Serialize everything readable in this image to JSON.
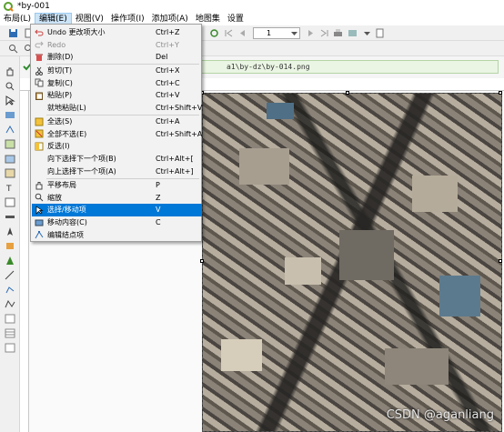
{
  "window": {
    "title": "*by-001"
  },
  "menubar": [
    {
      "label": "布局(L)"
    },
    {
      "label": "编辑(E)"
    },
    {
      "label": "视图(V)"
    },
    {
      "label": "操作项(I)"
    },
    {
      "label": "添加项(A)"
    },
    {
      "label": "地图集"
    },
    {
      "label": "设置"
    }
  ],
  "toolbar": {
    "page_selector_value": "1"
  },
  "pathbar": {
    "path_text": "a1\\by-dz\\by-014.png"
  },
  "edit_menu": {
    "items": [
      {
        "label": "Undo 更改项大小",
        "shortcut": "Ctrl+Z",
        "icon": "undo-icon",
        "enabled": true
      },
      {
        "label": "Redo",
        "shortcut": "Ctrl+Y",
        "icon": "redo-icon",
        "enabled": false
      },
      {
        "label": "删除(D)",
        "shortcut": "Del",
        "icon": "trash-icon",
        "enabled": true
      },
      {
        "label": "剪切(T)",
        "shortcut": "Ctrl+X",
        "icon": "cut-icon",
        "enabled": true
      },
      {
        "label": "复制(C)",
        "shortcut": "Ctrl+C",
        "icon": "copy-icon",
        "enabled": true
      },
      {
        "label": "粘贴(P)",
        "shortcut": "Ctrl+V",
        "icon": "paste-icon",
        "enabled": true
      },
      {
        "label": "就地粘贴(L)",
        "shortcut": "Ctrl+Shift+V",
        "icon": "",
        "enabled": true
      },
      {
        "label": "全选(S)",
        "shortcut": "Ctrl+A",
        "icon": "select-all-icon",
        "enabled": true
      },
      {
        "label": "全部不选(E)",
        "shortcut": "Ctrl+Shift+A",
        "icon": "deselect-all-icon",
        "enabled": true
      },
      {
        "label": "反选(I)",
        "shortcut": "",
        "icon": "invert-selection-icon",
        "enabled": true
      },
      {
        "label": "向下选择下一个项(B)",
        "shortcut": "Ctrl+Alt+[",
        "icon": "",
        "enabled": true
      },
      {
        "label": "向上选择下一个项(A)",
        "shortcut": "Ctrl+Alt+]",
        "icon": "",
        "enabled": true
      },
      {
        "label": "平移布局",
        "shortcut": "P",
        "icon": "pan-hand-icon",
        "enabled": true
      },
      {
        "label": "缩放",
        "shortcut": "Z",
        "icon": "zoom-icon",
        "enabled": true
      },
      {
        "label": "选择/移动项",
        "shortcut": "V",
        "icon": "select-move-icon",
        "enabled": true,
        "highlighted": true
      },
      {
        "label": "移动内容(C)",
        "shortcut": "C",
        "icon": "move-content-icon",
        "enabled": true
      },
      {
        "label": "编辑结点项",
        "shortcut": "",
        "icon": "edit-nodes-icon",
        "enabled": true
      }
    ]
  },
  "watermark": {
    "text": "CSDN @aganliang"
  },
  "colors": {
    "highlight": "#0078d7",
    "menu_bg": "#f2f2f2",
    "pathbar_bg": "#eaf5e3"
  }
}
